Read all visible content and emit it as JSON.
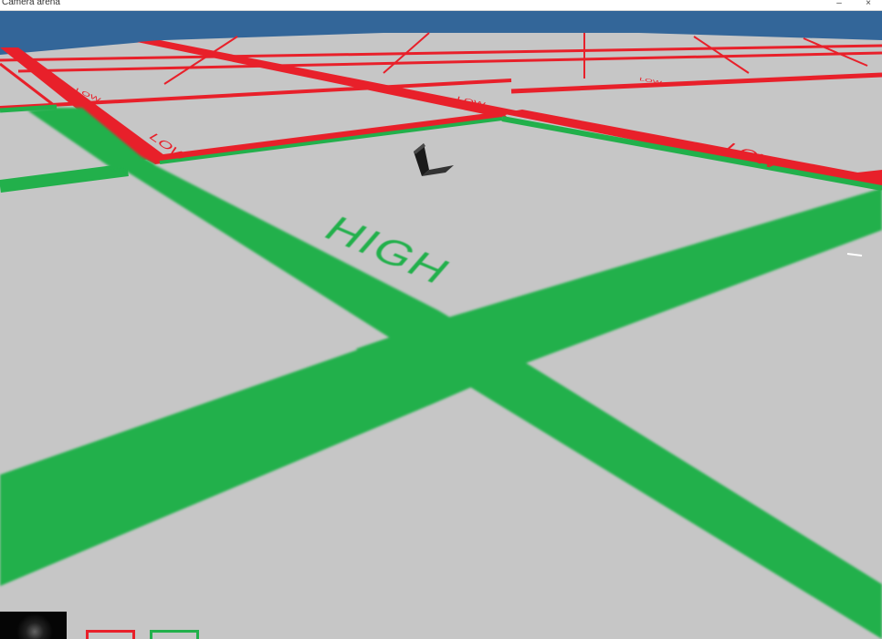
{
  "window": {
    "title": "Camera arena",
    "minimize_glyph": "–",
    "close_glyph": "×"
  },
  "scene": {
    "sky_color": "#336699",
    "floor_color": "#c6c6c6",
    "low_zone_color": "#e8202a",
    "high_zone_color": "#22b04b",
    "labels": {
      "high": "HIGH",
      "low": "LOW"
    },
    "robot_icon": "cube-robot-icon"
  },
  "legend": {
    "low_color": "#e8202a",
    "high_color": "#22b04b"
  },
  "minimap": {
    "icon": "camera-feed-icon"
  }
}
